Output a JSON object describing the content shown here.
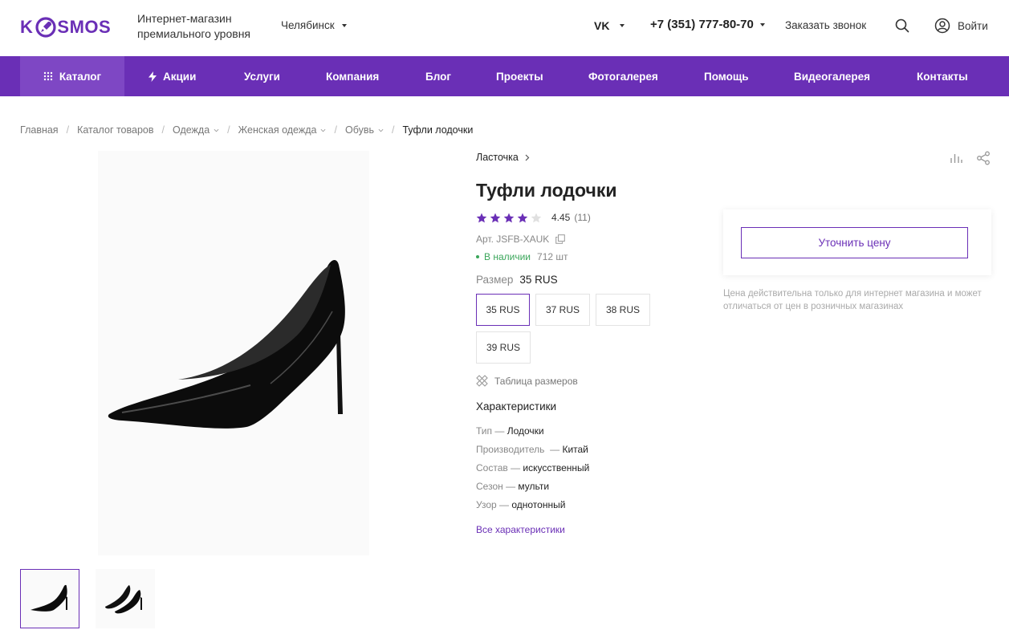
{
  "header": {
    "logo_start": "K",
    "logo_end": "SMOS",
    "tagline_line1": "Интернет-магазин",
    "tagline_line2": "премиального уровня",
    "city": "Челябинск",
    "vk_label": "VK",
    "phone": "+7 (351) 777-80-70",
    "callback": "Заказать звонок",
    "login": "Войти"
  },
  "nav": {
    "items": [
      "Каталог",
      "Акции",
      "Услуги",
      "Компания",
      "Блог",
      "Проекты",
      "Фотогалерея",
      "Помощь",
      "Видеогалерея",
      "Контакты"
    ]
  },
  "breadcrumbs": [
    "Главная",
    "Каталог товаров",
    "Одежда",
    "Женская одежда",
    "Обувь",
    "Туфли лодочки"
  ],
  "product": {
    "brand": "Ласточка",
    "title": "Туфли лодочки",
    "rating_value": "4.45",
    "rating_count": "(11)",
    "rating_stars": 4,
    "article": "Арт. JSFB-XAUK",
    "stock_status": "В наличии",
    "stock_qty": "712 шт",
    "size_label": "Размер",
    "size_selected": "35 RUS",
    "sizes": [
      "35 RUS",
      "37 RUS",
      "38 RUS",
      "39 RUS"
    ],
    "size_table": "Таблица размеров",
    "specs_title": "Характеристики",
    "specs": [
      {
        "name": "Тип",
        "value": "Лодочки"
      },
      {
        "name": "Производитель",
        "value": "Китай"
      },
      {
        "name": "Состав",
        "value": "искусственный"
      },
      {
        "name": "Сезон",
        "value": "мульти"
      },
      {
        "name": "Узор",
        "value": "однотонный"
      }
    ],
    "all_specs": "Все характеристики"
  },
  "buy": {
    "price_button": "Уточнить цену",
    "note": "Цена действительна только для интернет магазина и может отличаться от цен в розничных магазинах"
  },
  "colors": {
    "accent": "#6a2fb6",
    "in_stock": "#3aa65a"
  }
}
